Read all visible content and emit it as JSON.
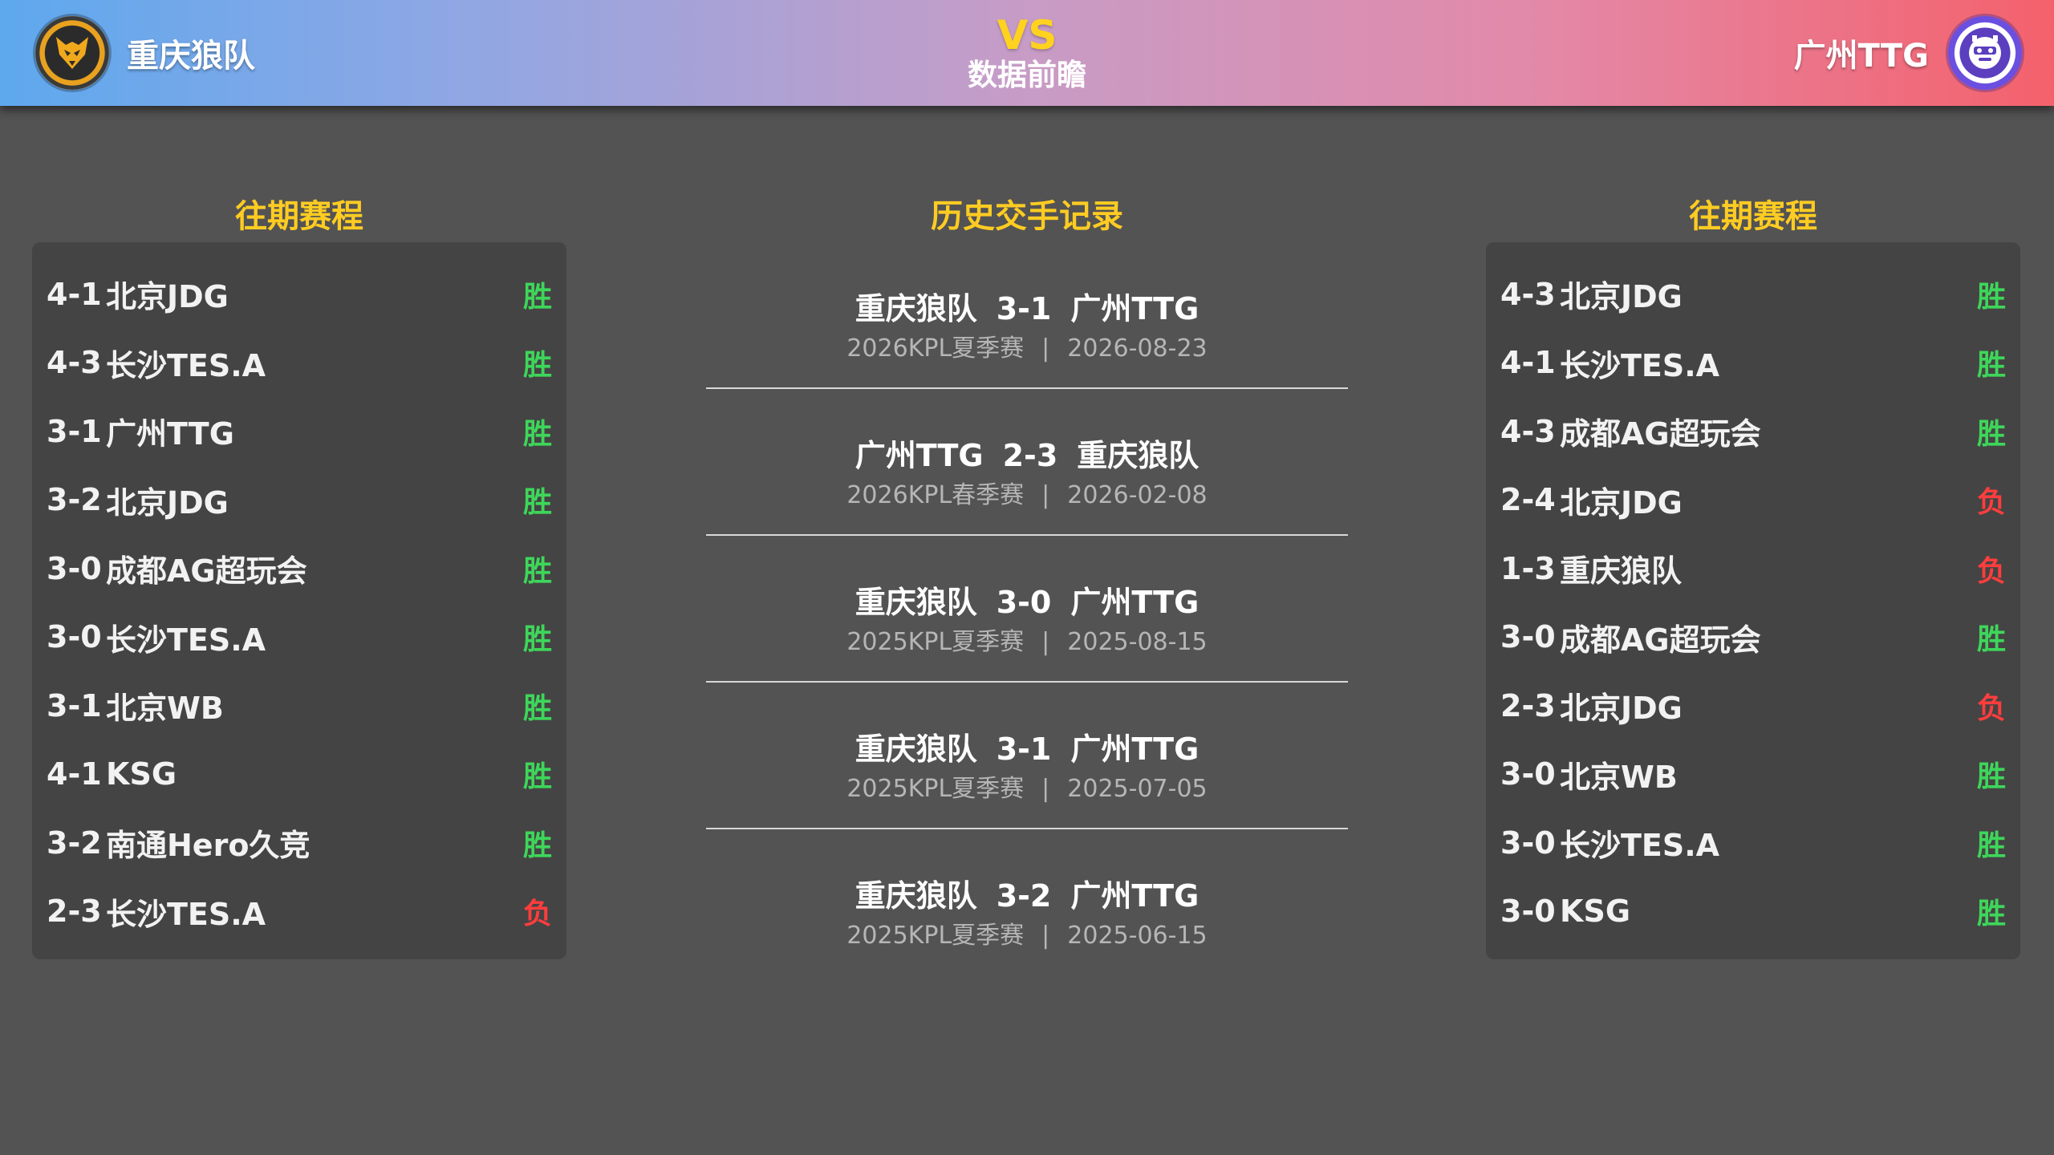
{
  "header": {
    "left_team": "重庆狼队",
    "right_team": "广州TTG",
    "vs": "VS",
    "subtitle": "数据前瞻"
  },
  "left_panel": {
    "title": "往期赛程",
    "rows": [
      {
        "score": "4-1",
        "opponent": "北京JDG",
        "result": "胜"
      },
      {
        "score": "4-3",
        "opponent": "长沙TES.A",
        "result": "胜"
      },
      {
        "score": "3-1",
        "opponent": "广州TTG",
        "result": "胜"
      },
      {
        "score": "3-2",
        "opponent": "北京JDG",
        "result": "胜"
      },
      {
        "score": "3-0",
        "opponent": "成都AG超玩会",
        "result": "胜"
      },
      {
        "score": "3-0",
        "opponent": "长沙TES.A",
        "result": "胜"
      },
      {
        "score": "3-1",
        "opponent": "北京WB",
        "result": "胜"
      },
      {
        "score": "4-1",
        "opponent": "KSG",
        "result": "胜"
      },
      {
        "score": "3-2",
        "opponent": "南通Hero久竞",
        "result": "胜"
      },
      {
        "score": "2-3",
        "opponent": "长沙TES.A",
        "result": "负"
      }
    ]
  },
  "right_panel": {
    "title": "往期赛程",
    "rows": [
      {
        "score": "4-3",
        "opponent": "北京JDG",
        "result": "胜"
      },
      {
        "score": "4-1",
        "opponent": "长沙TES.A",
        "result": "胜"
      },
      {
        "score": "4-3",
        "opponent": "成都AG超玩会",
        "result": "胜"
      },
      {
        "score": "2-4",
        "opponent": "北京JDG",
        "result": "负"
      },
      {
        "score": "1-3",
        "opponent": "重庆狼队",
        "result": "负"
      },
      {
        "score": "3-0",
        "opponent": "成都AG超玩会",
        "result": "胜"
      },
      {
        "score": "2-3",
        "opponent": "北京JDG",
        "result": "负"
      },
      {
        "score": "3-0",
        "opponent": "北京WB",
        "result": "胜"
      },
      {
        "score": "3-0",
        "opponent": "长沙TES.A",
        "result": "胜"
      },
      {
        "score": "3-0",
        "opponent": "KSG",
        "result": "胜"
      }
    ]
  },
  "head_to_head": {
    "title": "历史交手记录",
    "matches": [
      {
        "home": "重庆狼队",
        "score": "3-1",
        "away": "广州TTG",
        "event": "2026KPL夏季赛",
        "date": "2026-08-23"
      },
      {
        "home": "广州TTG",
        "score": "2-3",
        "away": "重庆狼队",
        "event": "2026KPL春季赛",
        "date": "2026-02-08"
      },
      {
        "home": "重庆狼队",
        "score": "3-0",
        "away": "广州TTG",
        "event": "2025KPL夏季赛",
        "date": "2025-08-15"
      },
      {
        "home": "重庆狼队",
        "score": "3-1",
        "away": "广州TTG",
        "event": "2025KPL夏季赛",
        "date": "2025-07-05"
      },
      {
        "home": "重庆狼队",
        "score": "3-2",
        "away": "广州TTG",
        "event": "2025KPL夏季赛",
        "date": "2025-06-15"
      }
    ],
    "separator": "|"
  },
  "colors": {
    "win": "#3ed65a",
    "loss": "#ff3d3d",
    "title": "#ffcc22"
  },
  "icons": {
    "left_logo": "wolf-logo",
    "right_logo": "ttg-logo"
  }
}
